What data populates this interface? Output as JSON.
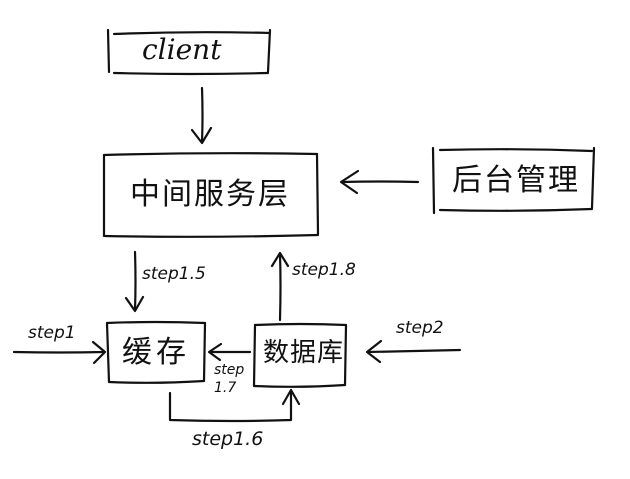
{
  "nodes": {
    "client": "client",
    "middleware": "中间服务层",
    "backend_admin": "后台管理",
    "cache": "缓存",
    "database": "数据库"
  },
  "edges": {
    "step1": "step1",
    "step1_5": "step1.5",
    "step1_6": "step1.6",
    "step1_7": "step 1.7",
    "step1_8": "step1.8",
    "step2": "step2"
  },
  "colors": {
    "ink": "#111111",
    "background": "#ffffff"
  }
}
